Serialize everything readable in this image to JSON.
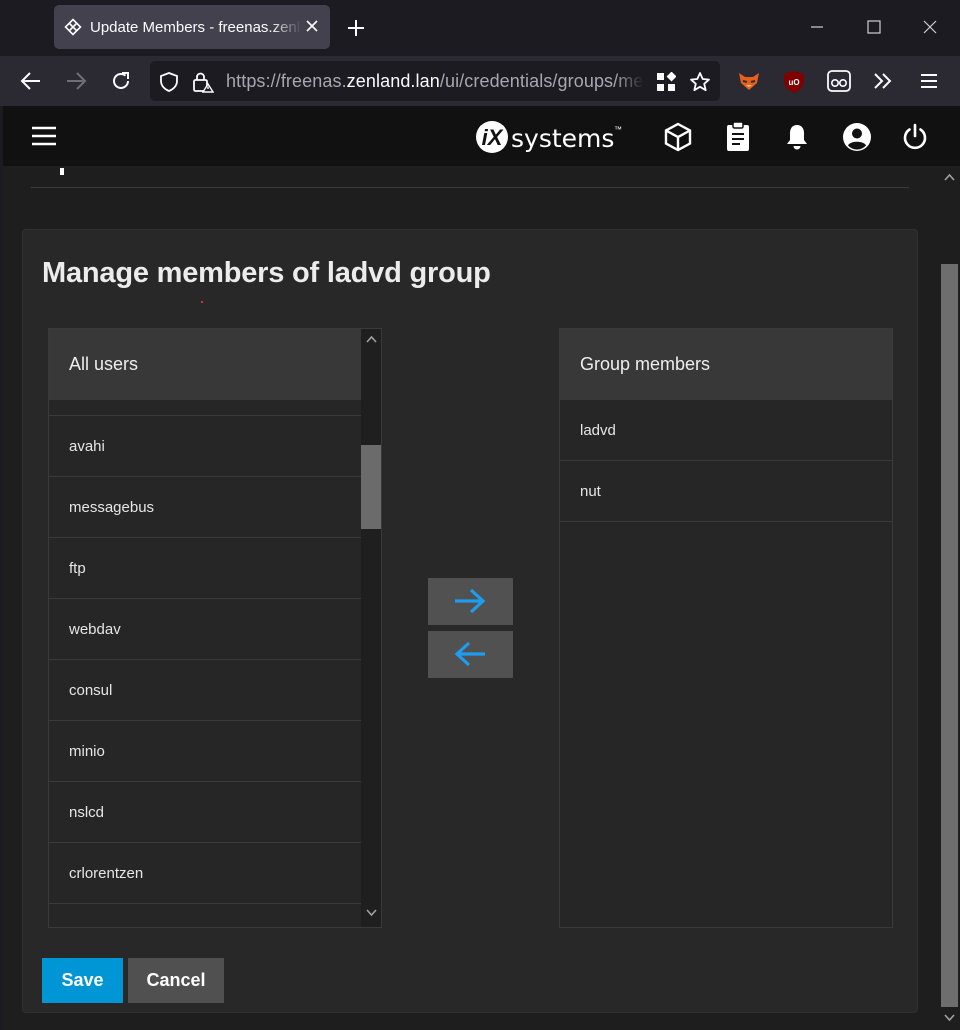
{
  "browser": {
    "tab_title": "Update Members - freenas.zenland.lan",
    "url_prefix": "https://freenas.",
    "url_domain": "zenland.lan",
    "url_path": "/ui/credentials/groups/members/"
  },
  "app": {
    "logo_letters": "iX",
    "logo_word": "systems",
    "logo_tm": "™"
  },
  "page": {
    "title": "Manage members of ladvd group"
  },
  "all_users": {
    "header": "All users",
    "items": [
      "avahi",
      "messagebus",
      "ftp",
      "webdav",
      "consul",
      "minio",
      "nslcd",
      "crlorentzen"
    ]
  },
  "group_members": {
    "header": "Group members",
    "items": [
      "ladvd",
      "nut"
    ]
  },
  "actions": {
    "save_label": "Save",
    "cancel_label": "Cancel"
  },
  "colors": {
    "accent": "#0095d5",
    "arrow": "#1e9cf0",
    "card_bg": "#282828",
    "topbar_bg": "#111111"
  }
}
